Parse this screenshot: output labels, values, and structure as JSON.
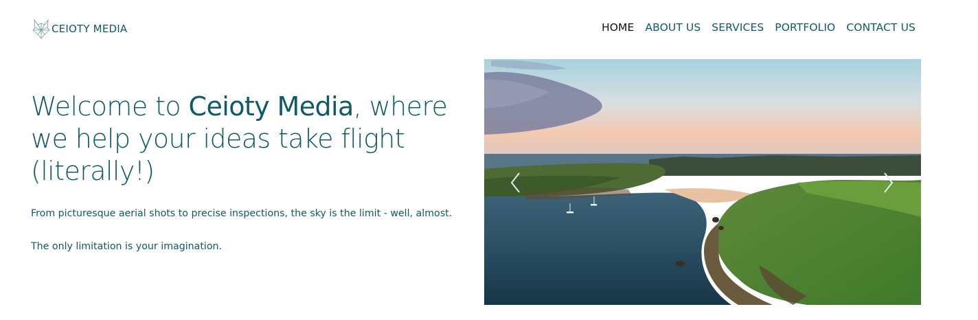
{
  "brand": {
    "logo_icon": "wolf-head-icon",
    "name": "CEIOTY MEDIA"
  },
  "nav": {
    "items": [
      {
        "label": "HOME",
        "active": true
      },
      {
        "label": "ABOUT US",
        "active": false
      },
      {
        "label": "SERVICES",
        "active": false
      },
      {
        "label": "PORTFOLIO",
        "active": false
      },
      {
        "label": "CONTACT US",
        "active": false
      }
    ]
  },
  "hero": {
    "title_prefix": "Welcome to ",
    "title_brand": "Ceioty Media",
    "title_suffix": ", where we help your ideas take flight (literally!)",
    "paragraph1": "From picturesque aerial shots to precise inspections, the sky is the limit - well, almost.",
    "paragraph2": "The only limitation is your imagination."
  },
  "slider": {
    "prev_icon": "chevron-left-icon",
    "next_icon": "chevron-right-icon"
  },
  "colors": {
    "primary": "#0e5a66",
    "active_nav": "#111111",
    "background": "#ffffff"
  }
}
